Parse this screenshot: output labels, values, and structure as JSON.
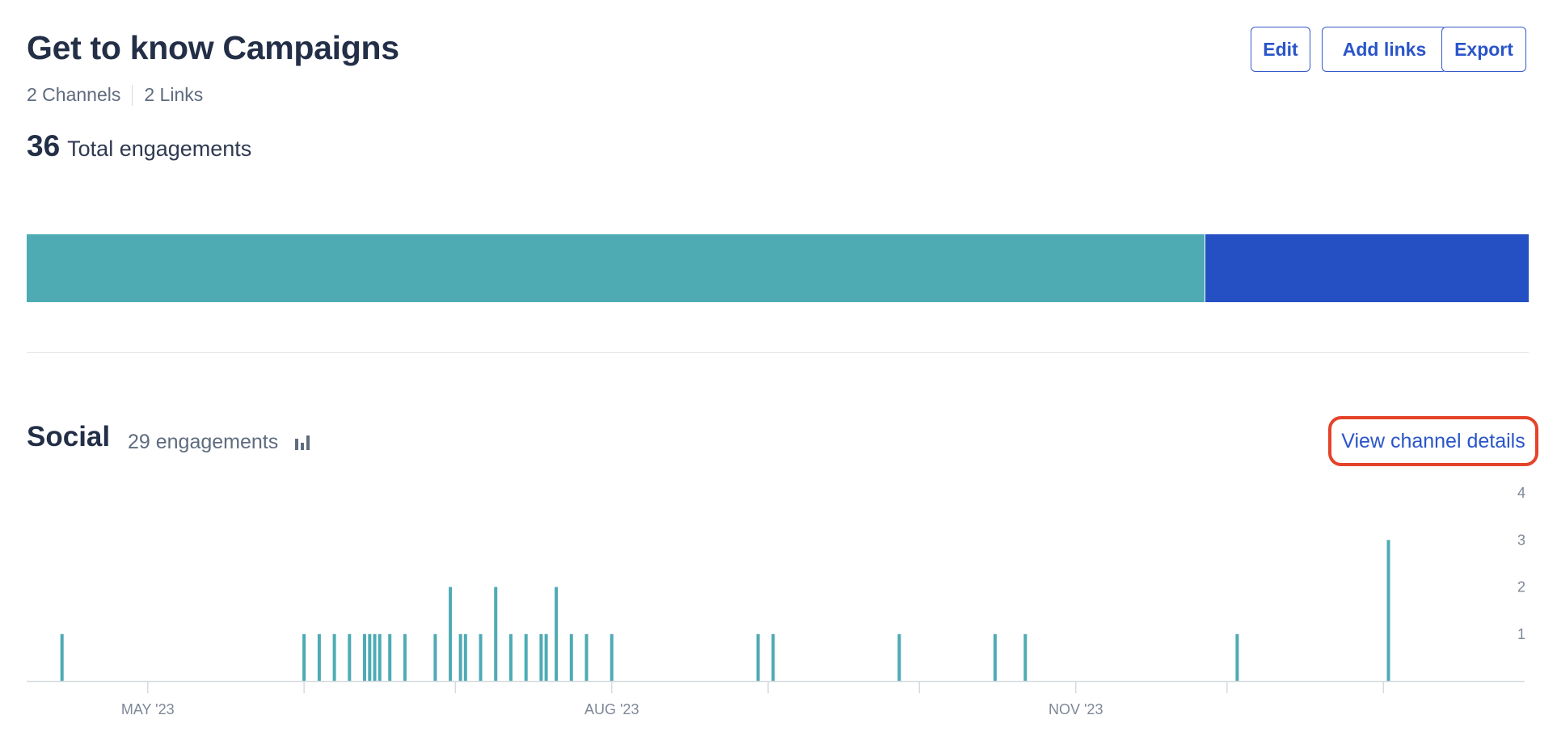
{
  "header": {
    "title": "Get to know Campaigns",
    "channels": "2 Channels",
    "links": "2 Links",
    "edit_label": "Edit",
    "add_links_label": "Add links",
    "export_label": "Export"
  },
  "summary": {
    "total_value": "36",
    "total_label": "Total engagements",
    "breakdown": [
      {
        "channel": "Social",
        "value": 29,
        "color": "#4eabb4"
      },
      {
        "channel": "Links",
        "value": 7,
        "color": "#2550c3"
      }
    ]
  },
  "section": {
    "title": "Social",
    "engagements": "29 engagements",
    "chart_icon": "bar-chart-icon",
    "view_details_label": "View channel details",
    "highlight_color": "#e4432a"
  },
  "chart_data": {
    "type": "bar",
    "title": "",
    "xlabel": "",
    "ylabel": "",
    "ylim": [
      0,
      4
    ],
    "y_ticks": [
      "1",
      "2",
      "3",
      "4"
    ],
    "x_ticks": [
      "MAY '23",
      "AUG '23",
      "NOV '23"
    ],
    "x_range": [
      "2023-04-07",
      "2024-01-29"
    ],
    "bar_color": "#4eabb4",
    "series": [
      {
        "values": [
          [
            "2023-04-14",
            1
          ],
          [
            "2023-06-01",
            1
          ],
          [
            "2023-06-04",
            1
          ],
          [
            "2023-06-07",
            1
          ],
          [
            "2023-06-10",
            1
          ],
          [
            "2023-06-13",
            1
          ],
          [
            "2023-06-14",
            1
          ],
          [
            "2023-06-15",
            1
          ],
          [
            "2023-06-16",
            1
          ],
          [
            "2023-06-18",
            1
          ],
          [
            "2023-06-21",
            1
          ],
          [
            "2023-06-27",
            1
          ],
          [
            "2023-06-30",
            2
          ],
          [
            "2023-07-02",
            1
          ],
          [
            "2023-07-03",
            1
          ],
          [
            "2023-07-06",
            1
          ],
          [
            "2023-07-09",
            2
          ],
          [
            "2023-07-12",
            1
          ],
          [
            "2023-07-15",
            1
          ],
          [
            "2023-07-18",
            1
          ],
          [
            "2023-07-19",
            1
          ],
          [
            "2023-07-21",
            2
          ],
          [
            "2023-07-24",
            1
          ],
          [
            "2023-07-27",
            1
          ],
          [
            "2023-08-01",
            1
          ],
          [
            "2023-08-30",
            1
          ],
          [
            "2023-09-02",
            1
          ],
          [
            "2023-09-27",
            1
          ],
          [
            "2023-10-16",
            1
          ],
          [
            "2023-10-22",
            1
          ],
          [
            "2023-12-03",
            1
          ],
          [
            "2024-01-02",
            3
          ]
        ]
      }
    ]
  }
}
